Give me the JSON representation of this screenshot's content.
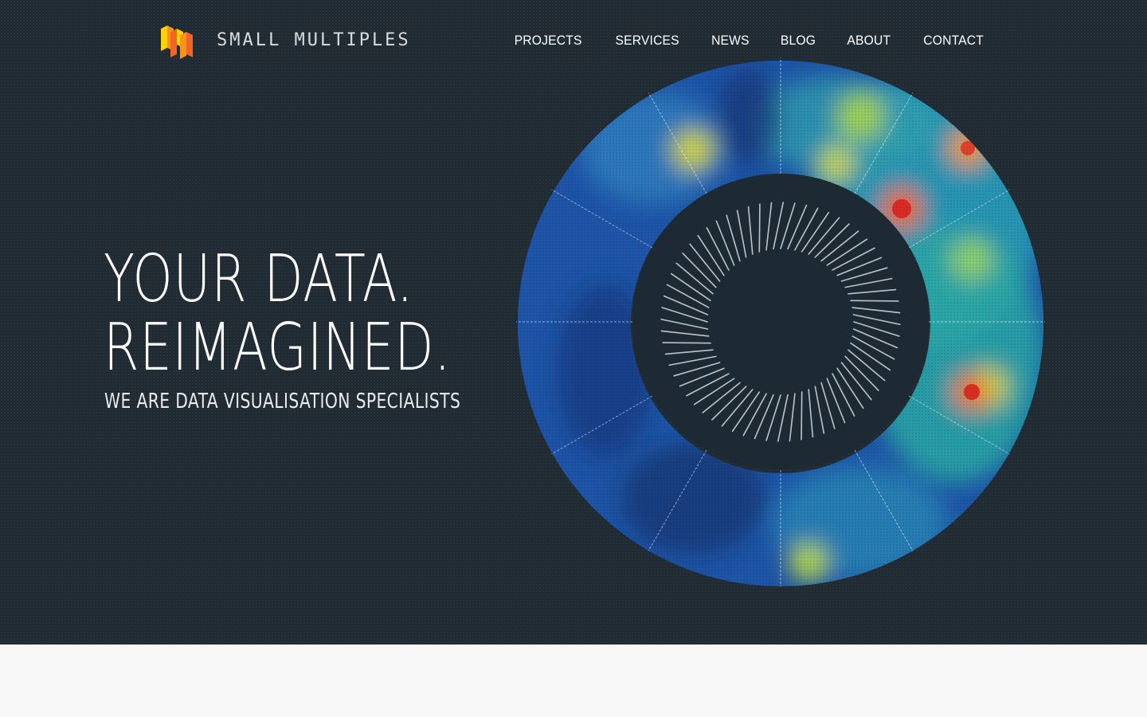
{
  "brand": {
    "name": "SMALL MULTIPLES",
    "logo_icon": "stacked-bars-logo-icon"
  },
  "nav": {
    "items": [
      {
        "label": "PROJECTS"
      },
      {
        "label": "SERVICES"
      },
      {
        "label": "NEWS"
      },
      {
        "label": "BLOG"
      },
      {
        "label": "ABOUT"
      },
      {
        "label": "CONTACT"
      }
    ]
  },
  "hero": {
    "headline_line1": "YOUR DATA.",
    "headline_line2": "REIMAGINED.",
    "subheadline": "WE ARE DATA VISUALISATION SPECIALISTS",
    "visual": "radial-heatmap-ring"
  },
  "colors": {
    "hero_background": "#1f2a33",
    "accent_orange": "#f26522",
    "accent_yellow": "#ffd200",
    "heat_low": "#1e4fa0",
    "heat_mid": "#2fb7a8",
    "heat_high": "#e0261e"
  }
}
